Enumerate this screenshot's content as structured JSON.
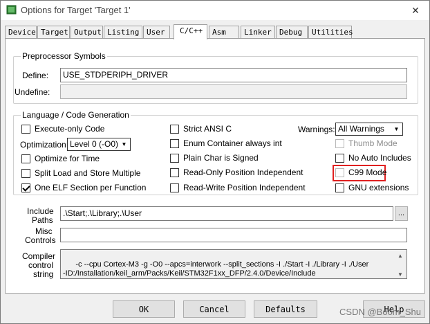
{
  "window": {
    "title": "Options for Target 'Target 1'"
  },
  "tabs": [
    {
      "label": "Device"
    },
    {
      "label": "Target"
    },
    {
      "label": "Output"
    },
    {
      "label": "Listing"
    },
    {
      "label": "User"
    },
    {
      "label": "C/C++"
    },
    {
      "label": "Asm"
    },
    {
      "label": "Linker"
    },
    {
      "label": "Debug"
    },
    {
      "label": "Utilities"
    }
  ],
  "active_tab": "C/C++",
  "preprocessor": {
    "group_title": "Preprocessor Symbols",
    "define_label": "Define:",
    "define_value": "USE_STDPERIPH_DRIVER",
    "undefine_label": "Undefine:",
    "undefine_value": ""
  },
  "language": {
    "group_title": "Language / Code Generation",
    "col1": [
      {
        "label": "Execute-only Code",
        "checked": false
      },
      {
        "label": "Optimize for Time",
        "checked": false
      },
      {
        "label": "Split Load and Store Multiple",
        "checked": false
      },
      {
        "label": "One ELF Section per Function",
        "checked": true
      }
    ],
    "optimization_label": "Optimization:",
    "optimization_value": "Level 0 (-O0)",
    "col2": [
      {
        "label": "Strict ANSI C",
        "checked": false
      },
      {
        "label": "Enum Container always int",
        "checked": false
      },
      {
        "label": "Plain Char is Signed",
        "checked": false
      },
      {
        "label": "Read-Only Position Independent",
        "checked": false
      },
      {
        "label": "Read-Write Position Independent",
        "checked": false
      }
    ],
    "warnings_label": "Warnings:",
    "warnings_value": "All Warnings",
    "col3": [
      {
        "label": "Thumb Mode",
        "checked": false,
        "disabled": true
      },
      {
        "label": "No Auto Includes",
        "checked": false
      },
      {
        "label": "C99 Mode",
        "checked": false
      },
      {
        "label": "GNU extensions",
        "checked": false
      }
    ]
  },
  "paths": {
    "include_label_1": "Include",
    "include_label_2": "Paths",
    "include_value": ".\\Start;.\\Library;.\\User",
    "browse_label": "...",
    "misc_label_1": "Misc",
    "misc_label_2": "Controls",
    "misc_value": "",
    "compiler_label_1": "Compiler",
    "compiler_label_2": "control",
    "compiler_label_3": "string",
    "compiler_value": "-c --cpu Cortex-M3 -g -O0 --apcs=interwork --split_sections -I ./Start -I ./Library -I ./User\n-ID:/Installation/keil_arm/Packs/Keil/STM32F1xx_DFP/2.4.0/Device/Include"
  },
  "buttons": {
    "ok": "OK",
    "cancel": "Cancel",
    "defaults": "Defaults",
    "help": "Help"
  },
  "watermark": "CSDN @Boom_Shu",
  "colors": {
    "highlight": "#e02020"
  }
}
